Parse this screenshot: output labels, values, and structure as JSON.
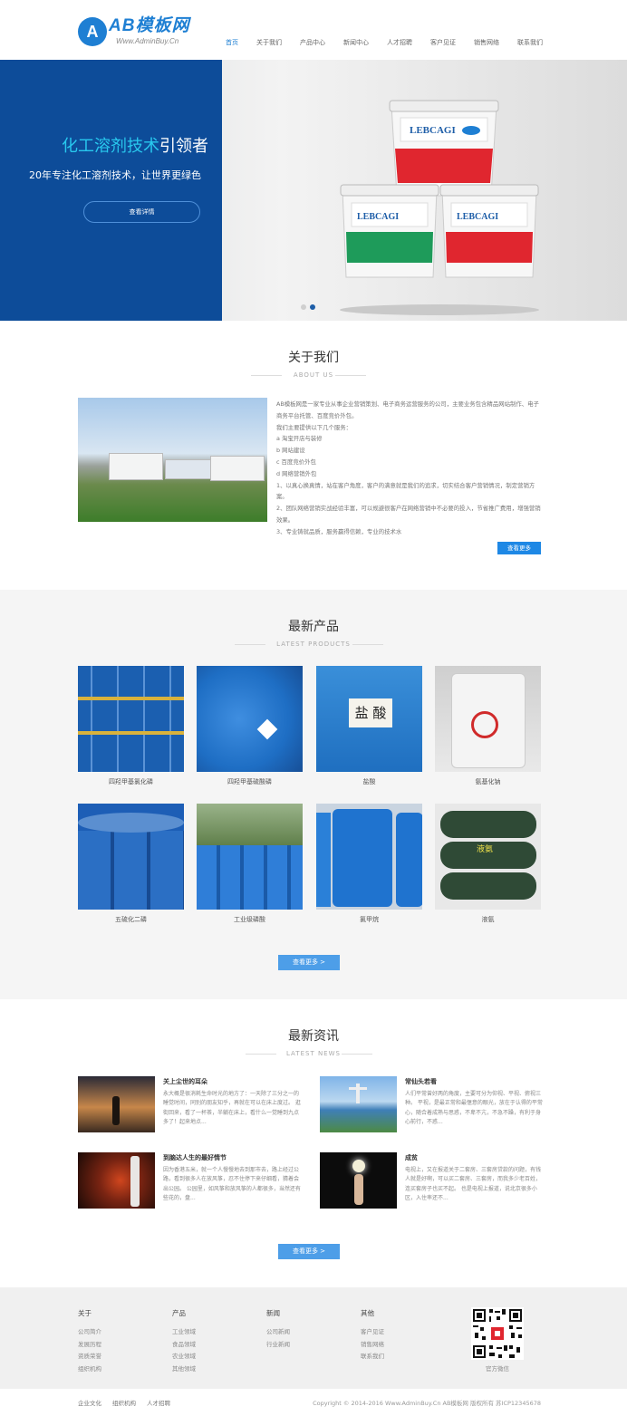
{
  "header": {
    "logo_text": "AB模板网",
    "logo_sub": "Www.AdminBuy.Cn",
    "nav": [
      "首页",
      "关于我们",
      "产品中心",
      "新闻中心",
      "人才招聘",
      "客户见证",
      "销售网络",
      "联系我们"
    ]
  },
  "banner": {
    "title_highlight": "化工溶剂技术",
    "title_rest": "引领者",
    "subtitle": "20年专注化工溶剂技术，让世界更绿色",
    "button": "查看详情",
    "bucket_brand": "LEBCAGI"
  },
  "about": {
    "title": "关于我们",
    "subtitle": "ABOUT US",
    "paragraphs": [
      "AB模板网是一家专业从事企业营销策划、电子商务运营服务的公司，主要业务包含精品网站制作、电子商务平台托管、百度竞价外包。",
      "我们主要提供以下几个服务：",
      "a  淘宝开店与装修",
      "b  网站建设",
      "c  百度竞价外包",
      "d  网络营销外包",
      "1、以真心换真情，站在客户角度，客户的满意就是我们的追求，切实结合客户营销情况，制定营销方案。",
      "2、团队网络营销实战经验丰富，可以规避很客户在网络营销中不必要的投入，节省推广费用，增强营销效果。",
      "3、专业铸就品质，服务赢得信赖，专业的技术水"
    ],
    "more": "查看更多"
  },
  "products": {
    "title": "最新产品",
    "subtitle": "LATEST PRODUCTS",
    "items": [
      {
        "label": "四羟甲基氯化磷"
      },
      {
        "label": "四羟甲基硫酸磷"
      },
      {
        "label": "盐酸",
        "img_text": "盐 酸"
      },
      {
        "label": "氨基化钠"
      },
      {
        "label": "五硫化二磷"
      },
      {
        "label": "工业级磷酸"
      },
      {
        "label": "氯甲烷"
      },
      {
        "label": "液氨",
        "img_text": "液氨"
      }
    ],
    "more": "查看更多 >"
  },
  "news": {
    "title": "最新资讯",
    "subtitle": "LATEST NEWS",
    "items": [
      {
        "title": "关上尘世的耳朵",
        "desc": "永大概是很消耗生命时光的地方了：一天除了三分之一的睡觉时间，同别的朋友知乎，再就在可以在床上度过。 逛街回来，看了一杯茶，半躺在床上，看什么一觉睡到九点多了！起来地点..."
      },
      {
        "title": "常仙头若看",
        "desc": "人们平常曾好两的角度，主要可分为仰视、平视、俯视三种。 平视，是最正常和最惬意的眼光，放在于认得的平常心，随合着成熟与思惑，不卑不亢，不急不躁，有利于身心前行，不惑..."
      },
      {
        "title": "到脑达人生的最好情节",
        "desc": "因为香港五米，就一个人慢慢地去到那市去，路上经过公路，看到很多人在放风筝，忍不住停下来仔细看，猜着会出公园。 公园里，如风筝和放风筝的人都很多，当然还有些花的，盘..."
      },
      {
        "title": "成贫",
        "desc": "电视上，又在报道关于二套房、三套房贷款的问题，有钱人就是好啊，可以买二套房、三套房，而我多少老百姓，连买套房子也买不起。 也是电视上报道，说北京很多小区，入住率还不..."
      }
    ],
    "more": "查看更多 >"
  },
  "footer": {
    "columns": [
      {
        "head": "关于",
        "items": [
          "公司简介",
          "发展历程",
          "资质荣誉",
          "组织机构"
        ]
      },
      {
        "head": "产品",
        "items": [
          "工业领域",
          "食品领域",
          "农业领域",
          "其他领域"
        ]
      },
      {
        "head": "新闻",
        "items": [
          "公司新闻",
          "行业新闻"
        ]
      },
      {
        "head": "其他",
        "items": [
          "客户见证",
          "销售网络",
          "联系我们"
        ]
      }
    ],
    "qr_label": "官方微信",
    "bottom_links": [
      "企业文化",
      "组织机构",
      "人才招聘"
    ],
    "copyright": "Copyright © 2014-2016 Www.AdminBuy.Cn AB模板网 版权所有   苏ICP12345678"
  }
}
